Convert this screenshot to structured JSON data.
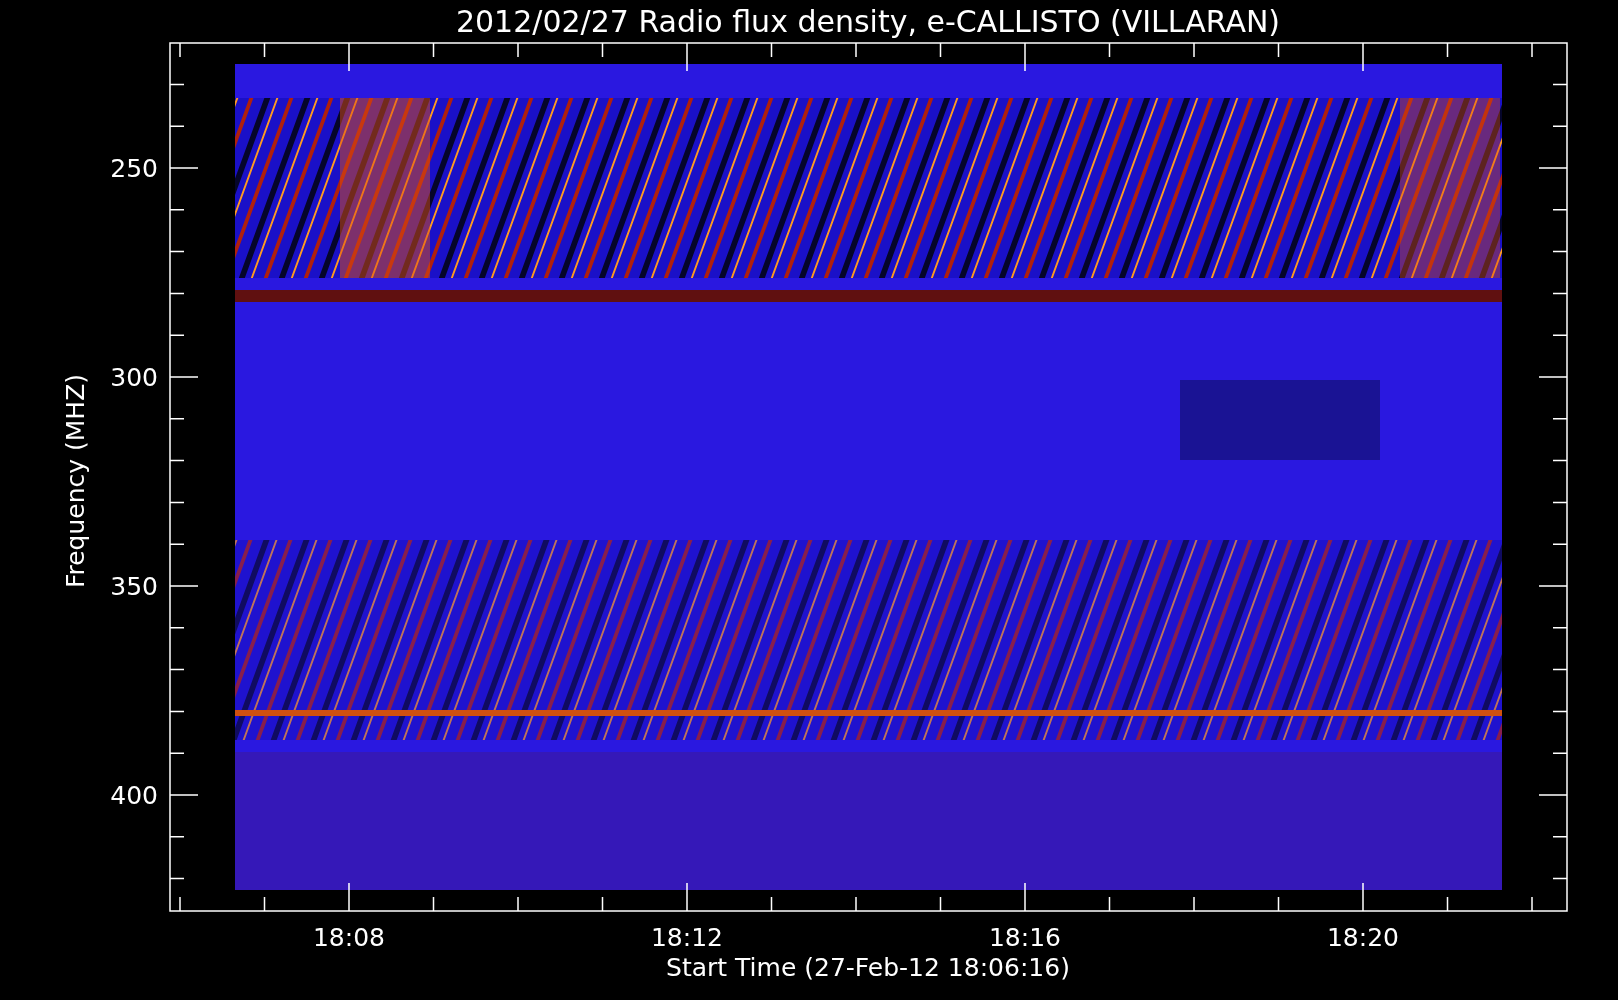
{
  "title": "2012/02/27  Radio flux density, e-CALLISTO (VILLARAN)",
  "y_axis": {
    "label": "Frequency (MHZ)",
    "ticks": [
      "250",
      "300",
      "350",
      "400"
    ]
  },
  "x_axis": {
    "label": "Start Time (27-Feb-12 18:06:16)",
    "ticks": [
      "18:08",
      "18:12",
      "18:16",
      "18:20"
    ]
  }
}
